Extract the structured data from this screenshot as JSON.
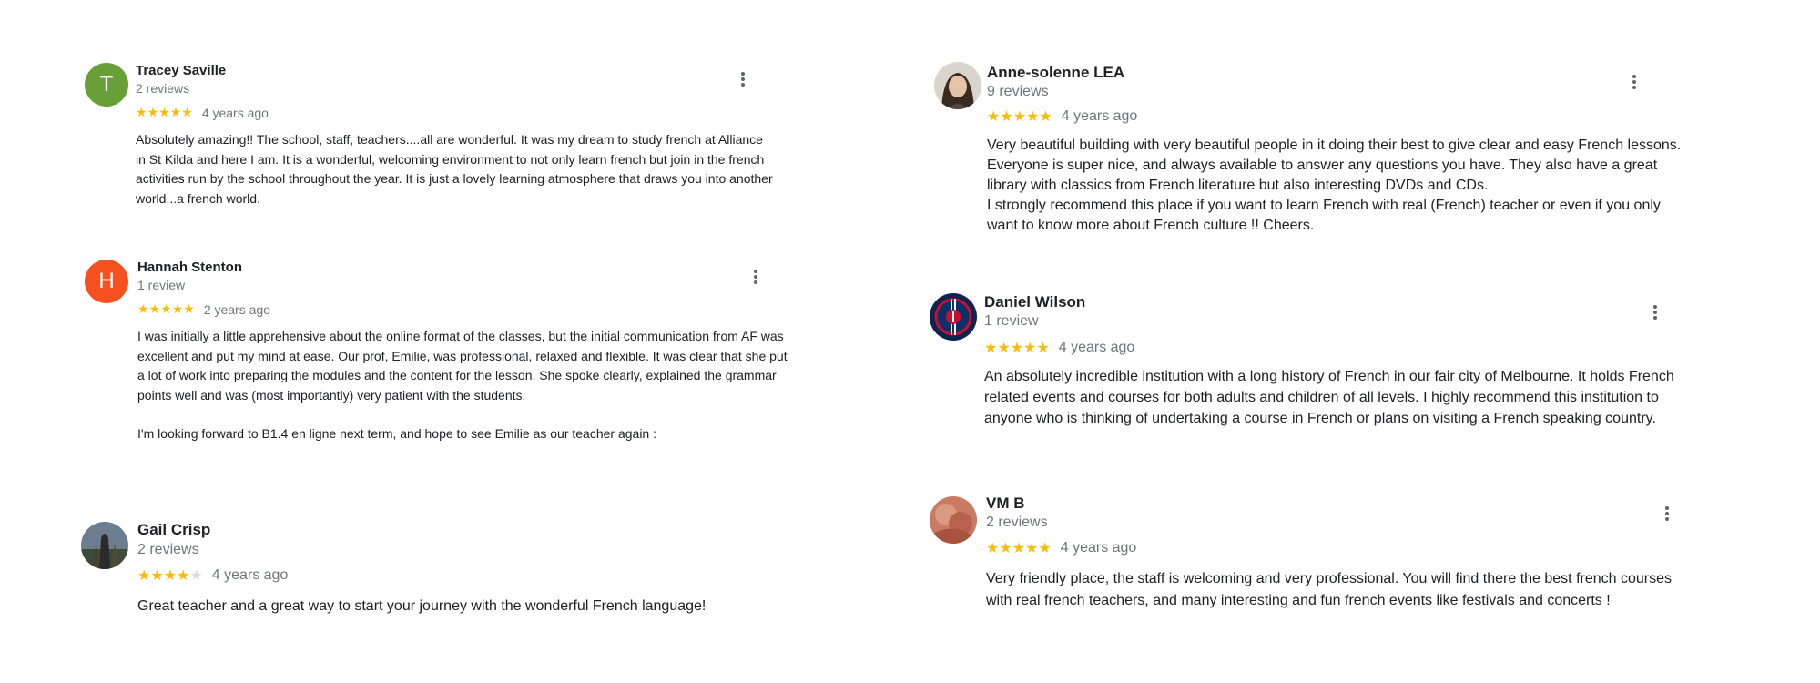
{
  "reviews": [
    {
      "name": "Tracey Saville",
      "count": "2 reviews",
      "stars": 5,
      "age": "4 years ago",
      "avatar_letter": "T",
      "avatar_color": "#689f38",
      "text": [
        "Absolutely amazing!! The school, staff, teachers....all are wonderful. It was my dream to study french at Alliance in St Kilda and here I am. It is a wonderful, welcoming environment to not only learn french but join in the french activities run by the school throughout the year. It is just a lovely learning atmosphere that draws you into another world...a french world."
      ]
    },
    {
      "name": "Hannah Stenton",
      "count": "1 review",
      "stars": 5,
      "age": "2 years ago",
      "avatar_letter": "H",
      "avatar_color": "#f4511e",
      "text": [
        "I was initially a little apprehensive about the online format of the classes, but the initial communication from AF was excellent and put my mind at ease. Our prof, Emilie, was professional, relaxed and flexible. It was clear that she put a lot of work into preparing the modules and the content for the lesson. She spoke clearly, explained the grammar points well and was (most importantly) very patient with the students.",
        "I'm looking forward to B1.4 en ligne next term, and hope to see Emilie as our teacher again :"
      ]
    },
    {
      "name": "Gail Crisp",
      "count": "2 reviews",
      "stars": 4,
      "age": "4 years ago",
      "text": [
        "Great teacher and a great way to start your journey with the wonderful French language!"
      ]
    },
    {
      "name": "Anne-solenne LEA",
      "count": "9 reviews",
      "stars": 5,
      "age": "4 years ago",
      "text": [
        "Very beautiful building with very beautiful people in it doing their best to give clear and easy French lessons. Everyone is super nice, and always available to answer any questions you have. They also have a great library with classics from French literature but also interesting DVDs and CDs.",
        "I strongly recommend this place if you want to learn French with real (French) teacher or even if you only want to know more about French culture !! Cheers."
      ]
    },
    {
      "name": "Daniel Wilson",
      "count": "1 review",
      "stars": 5,
      "age": "4 years ago",
      "text": [
        "An absolutely incredible institution with a long history of French in our fair city of Melbourne. It holds French related events and courses for both adults and children of all levels. I highly recommend this institution to anyone who is thinking of undertaking a course in French or plans on visiting a French speaking country."
      ]
    },
    {
      "name": "VM B",
      "count": "2 reviews",
      "stars": 5,
      "age": "4 years ago",
      "text": [
        "Very friendly place, the staff is welcoming and very professional. You will find there the best french courses with real french teachers, and many interesting and fun  french events like festivals and concerts !"
      ]
    }
  ],
  "icons": {
    "star": "star-icon",
    "menu": "more-vert-icon"
  },
  "colors": {
    "star_filled": "#fbbc04",
    "star_empty": "#dadce0",
    "secondary_text": "#70757a"
  }
}
